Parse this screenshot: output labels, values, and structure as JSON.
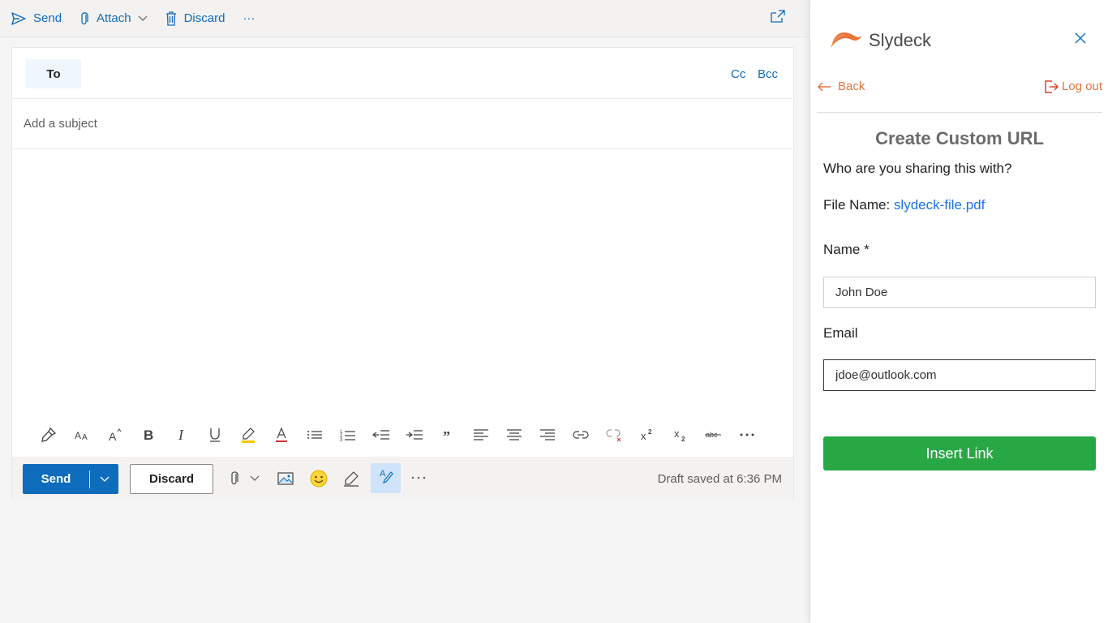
{
  "toolbar": {
    "send_label": "Send",
    "attach_label": "Attach",
    "discard_label": "Discard",
    "more_label": "···"
  },
  "compose": {
    "to_label": "To",
    "cc_label": "Cc",
    "bcc_label": "Bcc",
    "subject_placeholder": "Add a subject"
  },
  "format_bar": {
    "icons": [
      "format-painter-icon",
      "font-size-icon",
      "grow-font-icon",
      "bold-icon",
      "italic-icon",
      "underline-icon",
      "highlight-icon",
      "font-color-icon",
      "bullets-icon",
      "numbering-icon",
      "decrease-indent-icon",
      "increase-indent-icon",
      "quote-icon",
      "align-left-icon",
      "align-center-icon",
      "align-right-icon",
      "link-icon",
      "unlink-icon",
      "superscript-icon",
      "subscript-icon",
      "strikethrough-icon",
      "more-icon"
    ]
  },
  "action_bar": {
    "send_label": "Send",
    "discard_label": "Discard",
    "more_label": "···",
    "draft_status": "Draft saved at 6:36 PM"
  },
  "addin": {
    "brand": "Slydeck",
    "back_label": "Back",
    "logout_label": "Log out",
    "title": "Create Custom URL",
    "subtitle": "Who are you sharing this with?",
    "file_prefix": "File Name:",
    "file_name": "slydeck-file.pdf",
    "name_label": "Name *",
    "name_value": "John Doe",
    "email_label": "Email",
    "email_value": "jdoe@outlook.com",
    "insert_label": "Insert Link",
    "colors": {
      "accent": "#e8743b",
      "button": "#28a745",
      "link": "#1a73e8"
    }
  },
  "colors": {
    "primary": "#0f6cbd"
  }
}
